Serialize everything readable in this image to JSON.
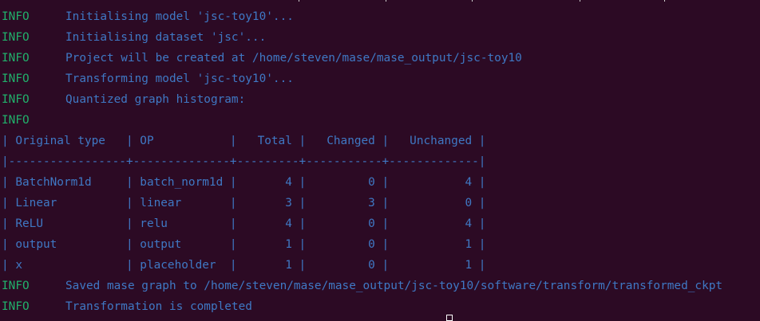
{
  "log": {
    "level_label": "INFO",
    "messages": [
      "Initialising model 'jsc-toy10'...",
      "Initialising dataset 'jsc'...",
      "Project will be created at /home/steven/mase/mase_output/jsc-toy10",
      "Transforming model 'jsc-toy10'...",
      "Quantized graph histogram:",
      ""
    ],
    "after_messages": [
      "Saved mase graph to /home/steven/mase/mase_output/jsc-toy10/software/transform/transformed_ckpt",
      "Transformation is completed"
    ]
  },
  "table": {
    "header": "| Original type   | OP           |   Total |   Changed |   Unchanged |",
    "separator": "|-----------------+--------------+---------+-----------+-------------|",
    "rows": [
      "| BatchNorm1d     | batch_norm1d |       4 |         0 |           4 |",
      "| Linear          | linear       |       3 |         3 |           0 |",
      "| ReLU            | relu         |       4 |         0 |           4 |",
      "| output          | output       |       1 |         0 |           1 |",
      "| x               | placeholder  |       1 |         0 |           1 |"
    ]
  },
  "colors": {
    "background": "#2c0a24",
    "info_level": "#21b06b",
    "message_text": "#3f78c4"
  }
}
